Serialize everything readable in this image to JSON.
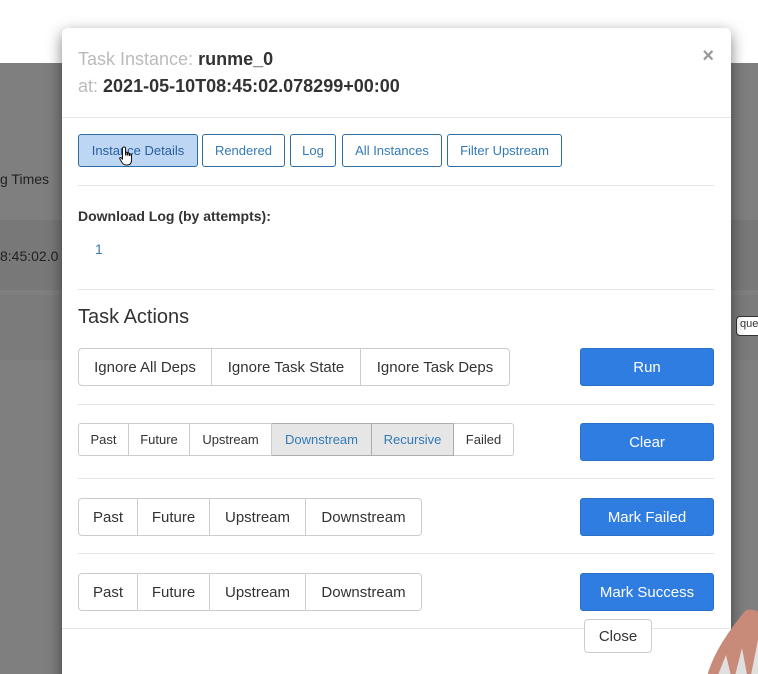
{
  "background": {
    "col_header": "g Times",
    "row_value": "8:45:02.0",
    "badge": "que"
  },
  "modal": {
    "title_prefix": "Task Instance:",
    "task_id": "runme_0",
    "at_prefix": "at:",
    "execution_date": "2021-05-10T08:45:02.078299+00:00",
    "close_symbol": "×"
  },
  "tabs": [
    "Instance Details",
    "Rendered",
    "Log",
    "All Instances",
    "Filter Upstream"
  ],
  "download_log": {
    "label": "Download Log (by attempts):",
    "attempts": [
      "1"
    ]
  },
  "task_actions": {
    "heading": "Task Actions",
    "run": {
      "options": [
        "Ignore All Deps",
        "Ignore Task State",
        "Ignore Task Deps"
      ],
      "button": "Run"
    },
    "clear": {
      "options": [
        "Past",
        "Future",
        "Upstream",
        "Downstream",
        "Recursive",
        "Failed"
      ],
      "active": [
        "Downstream",
        "Recursive"
      ],
      "button": "Clear"
    },
    "mark_failed": {
      "options": [
        "Past",
        "Future",
        "Upstream",
        "Downstream"
      ],
      "button": "Mark Failed"
    },
    "mark_success": {
      "options": [
        "Past",
        "Future",
        "Upstream",
        "Downstream"
      ],
      "button": "Mark Success"
    }
  },
  "footer": {
    "close_label": "Close"
  },
  "colors": {
    "primary": "#2f7de1",
    "active_tab": "#bcd6f3",
    "link": "#337ab7"
  }
}
